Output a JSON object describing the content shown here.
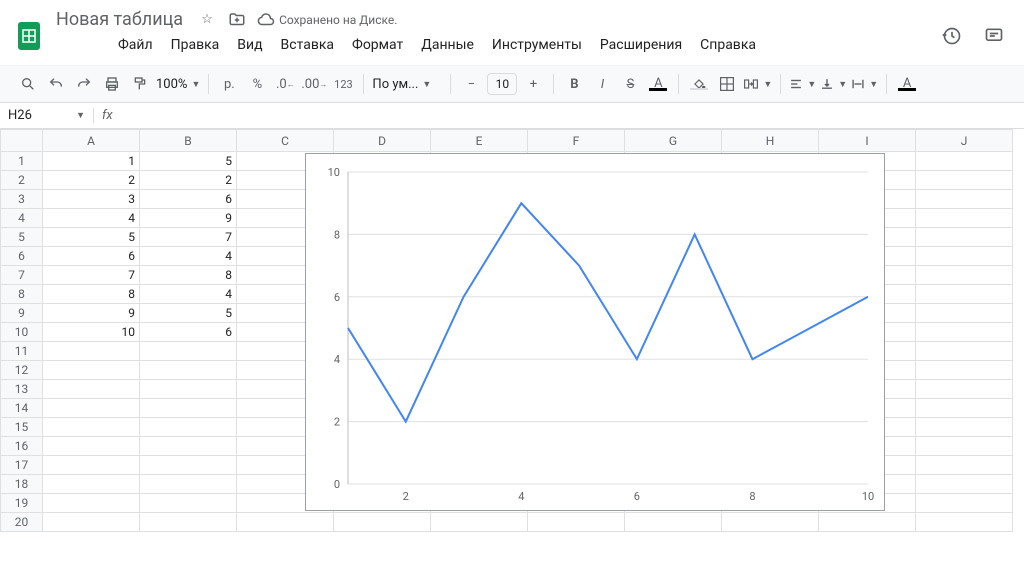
{
  "doc_title": "Новая таблица",
  "save_status": "Сохранено на Диске.",
  "menus": [
    "Файл",
    "Правка",
    "Вид",
    "Вставка",
    "Формат",
    "Данные",
    "Инструменты",
    "Расширения",
    "Справка"
  ],
  "toolbar": {
    "zoom": "100%",
    "currency": "р.",
    "percent": "%",
    "dec_down": ".0",
    "dec_up": ".00",
    "numfmt": "123",
    "font_name": "По ум...",
    "font_size": "10",
    "bold": "B",
    "italic": "I",
    "strike": "S"
  },
  "namebox": "H26",
  "columns": [
    "A",
    "B",
    "C",
    "D",
    "E",
    "F",
    "G",
    "H",
    "I",
    "J"
  ],
  "active_column": "H",
  "row_count": 20,
  "cells": {
    "A": [
      "1",
      "2",
      "3",
      "4",
      "5",
      "6",
      "7",
      "8",
      "9",
      "10"
    ],
    "B": [
      "5",
      "2",
      "6",
      "9",
      "7",
      "4",
      "8",
      "4",
      "5",
      "6"
    ]
  },
  "chart_data": {
    "type": "line",
    "x": [
      1,
      2,
      3,
      4,
      5,
      6,
      7,
      8,
      9,
      10
    ],
    "values": [
      5,
      2,
      6,
      9,
      7,
      4,
      8,
      4,
      5,
      6
    ],
    "ylim": [
      0,
      10
    ],
    "xticks": [
      2,
      4,
      6,
      8,
      10
    ],
    "yticks": [
      0,
      2,
      4,
      6,
      8,
      10
    ],
    "title": "",
    "xlabel": "",
    "ylabel": ""
  }
}
